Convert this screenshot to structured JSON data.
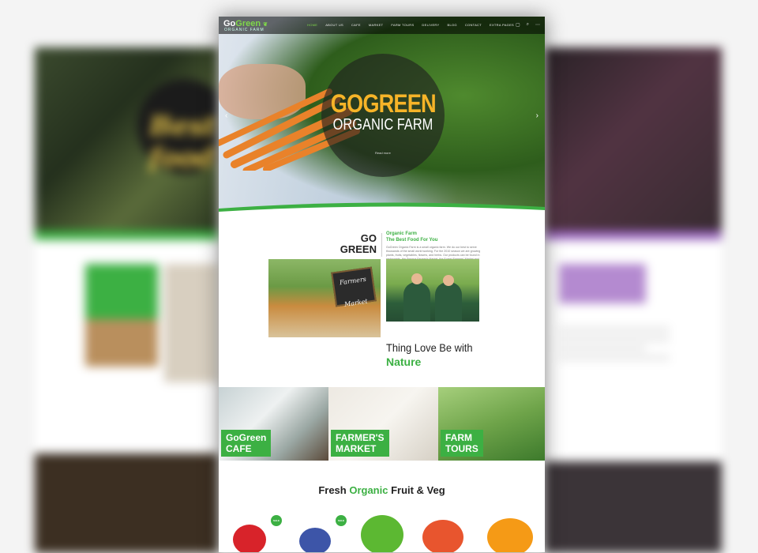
{
  "brand": {
    "name_a": "Go",
    "name_b": "Green",
    "tagline": "ORGANIC FARM"
  },
  "nav": {
    "items": [
      "HOME",
      "ABOUT US",
      "CAFE",
      "MARKET",
      "FARM TOURS",
      "DELIVERY",
      "BLOG",
      "CONTACT",
      "EXTRA PAGES"
    ],
    "active": "HOME"
  },
  "hero": {
    "title": "GOGREEN",
    "subtitle": "ORGANIC FARM",
    "button": "Read more"
  },
  "about": {
    "logo_line1": "GO",
    "logo_line2": "GREEN",
    "heading1": "Organic Farm",
    "heading2": "The Best Food For You",
    "body": "GoGreen Organic Farm is a small organic farm. We do our best to serve thousands of the small world working. For the 2010 season we are growing plants, fruits, vegetables, flowers, and herbs. Our products can be found in restaurants, the Smyrna Farmer's Market, the Forest Farmers' Market and the RP Community Market.",
    "board_line1": "Farmers",
    "board_line2": "Market",
    "headline": "Thing Love Be with",
    "headline_accent": "Nature"
  },
  "tiles": [
    {
      "line1": "GoGreen",
      "line2": "CAFE"
    },
    {
      "line1": "FARMER'S",
      "line2": "MARKET"
    },
    {
      "line1": "FARM",
      "line2": "TOURS"
    }
  ],
  "products": {
    "title_a": "Fresh ",
    "title_accent": "Organic",
    "title_b": " Fruit & Veg",
    "badge": "SALE"
  },
  "colors": {
    "accent": "#3cb043",
    "hero_title": "#f6b428",
    "text": "#222222"
  }
}
